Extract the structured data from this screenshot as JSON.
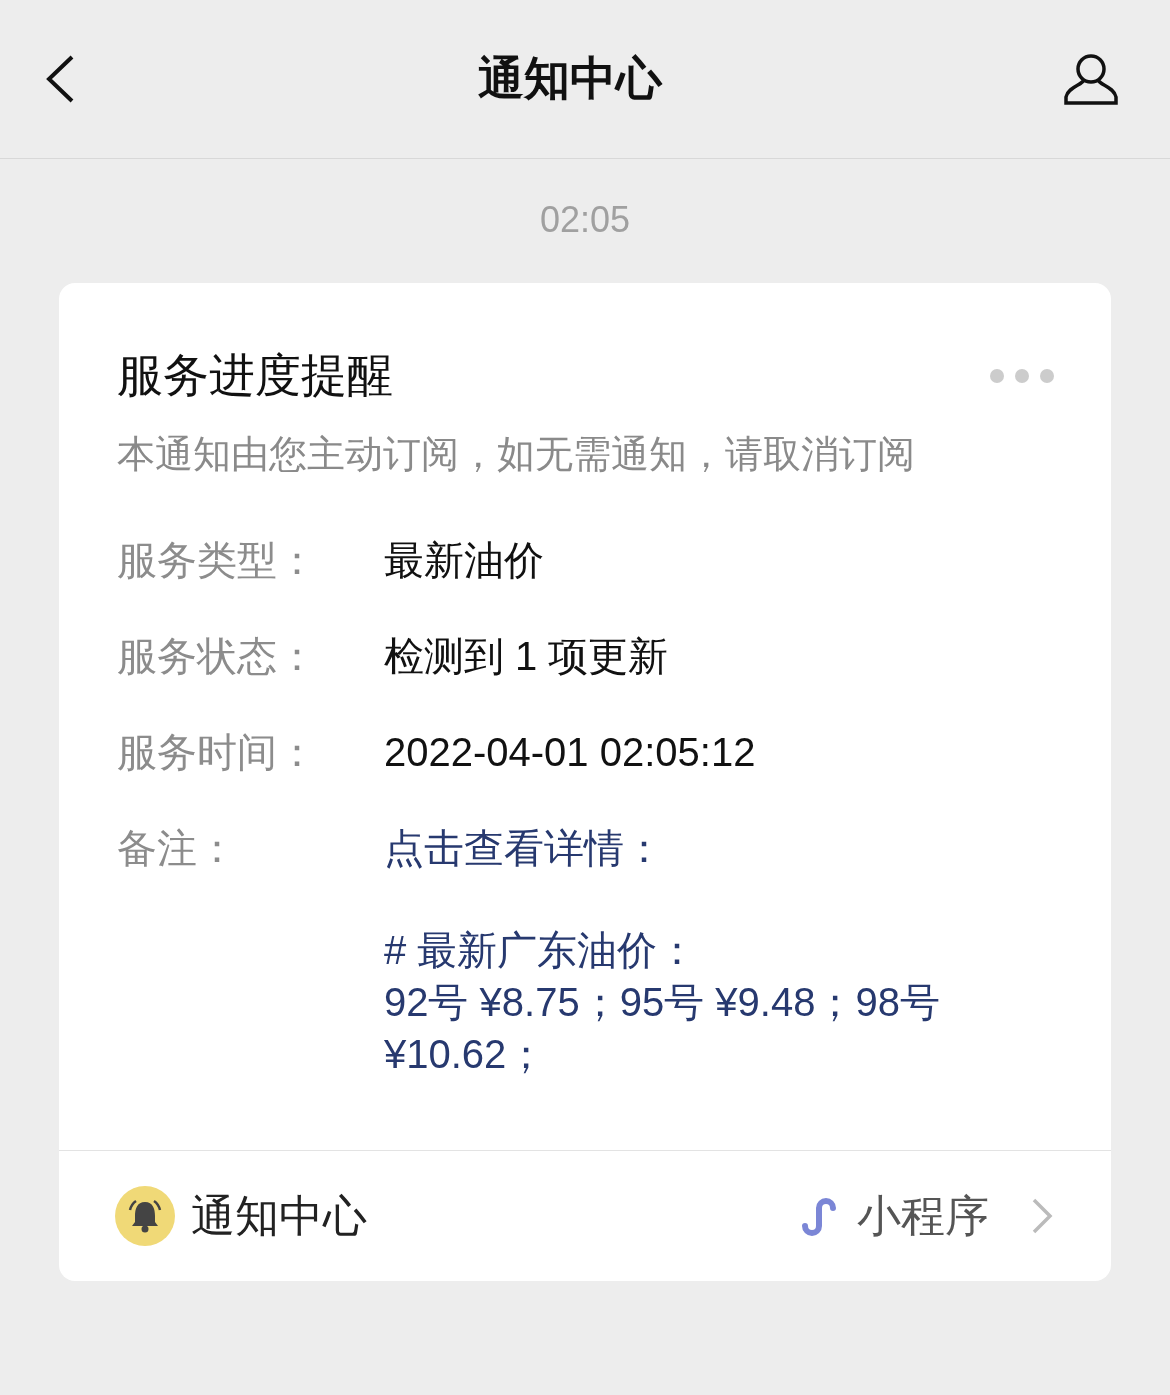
{
  "nav": {
    "title": "通知中心"
  },
  "time": "02:05",
  "card": {
    "title": "服务进度提醒",
    "subtitle": "本通知由您主动订阅，如无需通知，请取消订阅",
    "fields": [
      {
        "kind": "plain",
        "label": "服务类型：",
        "value": "最新油价"
      },
      {
        "kind": "plain",
        "label": "服务状态：",
        "value": "检测到 1 项更新"
      },
      {
        "kind": "plain",
        "label": "服务时间：",
        "value": "2022-04-01 02:05:12"
      },
      {
        "kind": "link",
        "label": "备注：",
        "value": "点击查看详情：",
        "lines": [
          "# 最新广东油价：",
          "92号 ¥8.75；95号 ¥9.48；98号 ¥10.62；"
        ]
      }
    ],
    "footer": {
      "source": "通知中心",
      "app": "小程序"
    }
  }
}
